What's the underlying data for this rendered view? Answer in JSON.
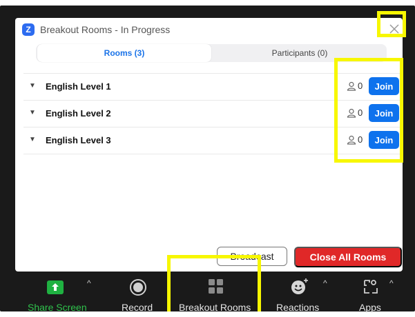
{
  "dialog": {
    "title": "Breakout Rooms - In Progress",
    "close_glyph": "✕",
    "logo_letter": "Z"
  },
  "tabs": [
    {
      "label": "Rooms (3)",
      "active": true
    },
    {
      "label": "Participants (0)",
      "active": false
    }
  ],
  "rooms": [
    {
      "name": "English Level 1",
      "count": "0",
      "join_label": "Join"
    },
    {
      "name": "English Level 2",
      "count": "0",
      "join_label": "Join"
    },
    {
      "name": "English Level 3",
      "count": "0",
      "join_label": "Join"
    }
  ],
  "actions": {
    "broadcast_label": "Broadcast",
    "close_all_label": "Close All Rooms"
  },
  "toolbar": [
    {
      "label": "Share Screen",
      "icon": "share-screen-icon"
    },
    {
      "label": "Record",
      "icon": "record-icon"
    },
    {
      "label": "Breakout Rooms",
      "icon": "breakout-rooms-icon"
    },
    {
      "label": "Reactions",
      "icon": "reactions-icon"
    },
    {
      "label": "Apps",
      "icon": "apps-icon"
    }
  ],
  "colors": {
    "accent": "#0e72ed",
    "danger": "#e02828",
    "share_green": "#1fb141",
    "highlight": "#f7f700",
    "toolbar_bg": "#1a1a1a"
  }
}
